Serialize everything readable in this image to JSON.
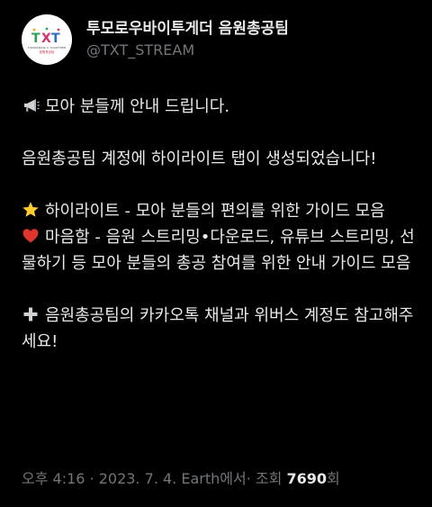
{
  "account": {
    "display_name": "투모로우바이투게더 음원총공팀",
    "handle": "@TXT_STREAM",
    "avatar_text_top": "TOMORROW X TOGETHER",
    "avatar_text_bottom": "음원총공팀"
  },
  "tweet": {
    "line_announce": "모아 분들께 안내 드립니다.",
    "line_tab": "음원총공팀 계정에 하이라이트 탭이 생성되었습니다!",
    "line_highlight": "하이라이트 - 모아 분들의 편의를 위한 가이드 모음",
    "line_heart": "마음함 - 음원 스트리밍•다운로드, 유튜브 스트리밍, 선물하기 등 모아 분들의 총공 참여를 위한 안내 가이드 모음",
    "line_kakao": "음원총공팀의 카카오톡 채널과 위버스 계정도 참고해주세요!",
    "icons": [
      "megaphone-icon",
      "star-icon",
      "heart-icon",
      "plus-icon"
    ]
  },
  "meta": {
    "time": "오후 4:16",
    "date": "2023. 7. 4.",
    "source": "Earth에서",
    "views_label": "조회",
    "views_count": "7690",
    "views_suffix": "회",
    "separator": "·"
  },
  "colors": {
    "background": "#000000",
    "text": "#e7e9ea",
    "secondary_text": "#71767b",
    "star": "#ffcc33",
    "heart": "#e0352f"
  }
}
